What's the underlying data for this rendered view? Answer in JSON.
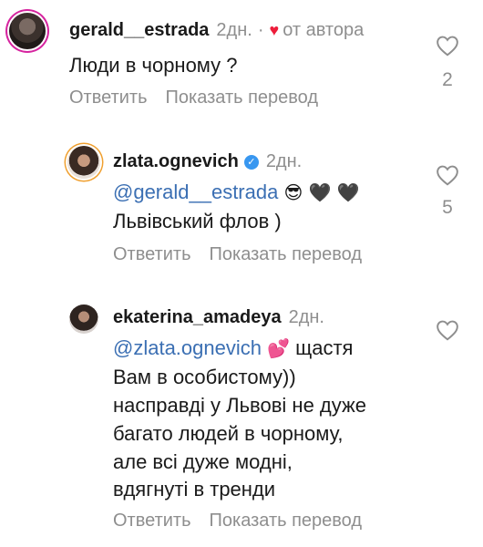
{
  "comments": [
    {
      "username": "gerald__estrada",
      "time": "2дн.",
      "author_like": "от автора",
      "text": "Люди в чорному ?",
      "reply_label": "Ответить",
      "translate_label": "Показать перевод",
      "likes": "2"
    },
    {
      "username": "zlata.ognevich",
      "time": "2дн.",
      "mention": "@gerald__estrada",
      "emojis": "😎 🖤 🖤",
      "text": "Львівський флов )",
      "reply_label": "Ответить",
      "translate_label": "Показать перевод",
      "likes": "5"
    },
    {
      "username": "ekaterina_amadeya",
      "time": "2дн.",
      "mention": "@zlata.ognevich",
      "emoji": "💕",
      "line1_rest": "щастя",
      "lines": [
        "Вам в особистому))",
        "насправді у Львові не дуже",
        "багато людей в чорному,",
        "але всі дуже модні,",
        "вдягнуті в тренди"
      ],
      "reply_label": "Ответить",
      "translate_label": "Показать перевод"
    }
  ],
  "colors": {
    "mention": "#3b6fb3",
    "muted": "#8e8e8e",
    "author_heart": "#ed1c3a",
    "verified": "#3897f0"
  }
}
